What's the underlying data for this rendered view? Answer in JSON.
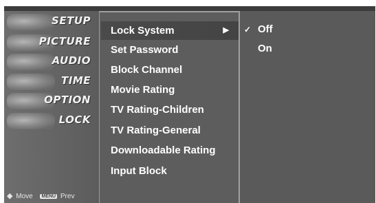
{
  "categories": [
    {
      "label": "SETUP",
      "icon": "satellite-dish-icon"
    },
    {
      "label": "PICTURE",
      "icon": "film-icon"
    },
    {
      "label": "AUDIO",
      "icon": "speaker-icon"
    },
    {
      "label": "TIME",
      "icon": "clock-icon"
    },
    {
      "label": "OPTION",
      "icon": "option-icon"
    },
    {
      "label": "LOCK",
      "icon": "lock-icon"
    }
  ],
  "footer": {
    "move_icon": "◆",
    "move_label": "Move",
    "menu_key": "MENU",
    "prev_label": "Prev"
  },
  "submenu": {
    "items": [
      {
        "label": "Lock System",
        "selected": true,
        "arrow": "▶"
      },
      {
        "label": "Set Password"
      },
      {
        "label": "Block Channel"
      },
      {
        "label": "Movie Rating"
      },
      {
        "label": "TV Rating-Children"
      },
      {
        "label": "TV Rating-General"
      },
      {
        "label": "Downloadable Rating"
      },
      {
        "label": "Input Block"
      }
    ]
  },
  "options": {
    "items": [
      {
        "label": "Off",
        "check": "✓"
      },
      {
        "label": "On",
        "check": ""
      }
    ]
  },
  "colors": {
    "background": "#5a5a5a",
    "text": "#ffffff",
    "selected_row": "#484848"
  }
}
